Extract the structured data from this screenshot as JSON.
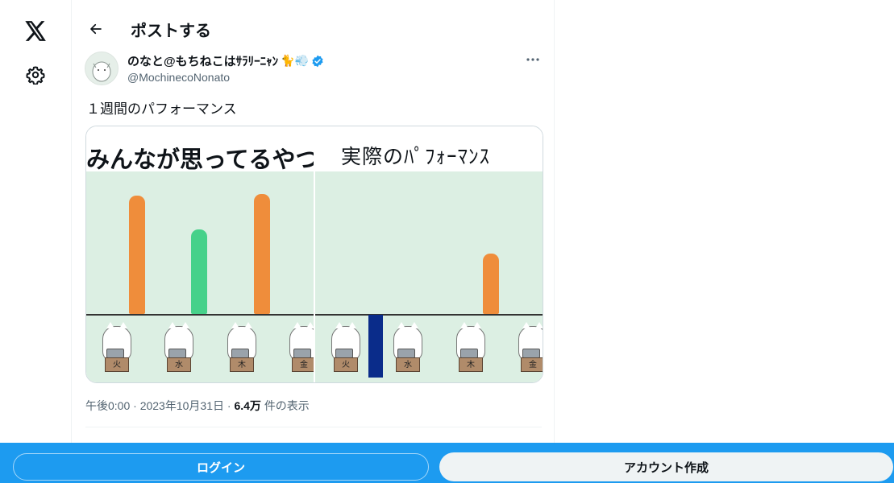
{
  "nav": {
    "logo_icon": "x-logo-icon",
    "settings_icon": "gear-icon"
  },
  "header": {
    "title": "ポストする",
    "back_icon": "arrow-left-icon"
  },
  "post": {
    "display_name": "のなと@もちねこはｻﾗﾘｰﾆｬﾝ",
    "name_emojis": "🐈💨",
    "handle": "@MochinecoNonato",
    "text": "１週間のパフォーマンス",
    "more_icon": "more-horizontal-icon"
  },
  "media": {
    "left_title": "みんなが思ってるやつ",
    "right_title": "実際のﾊﾟﾌｫｰﾏﾝｽ",
    "left_days": [
      "火",
      "水",
      "木",
      "金"
    ],
    "right_days": [
      "火",
      "水",
      "木",
      "金"
    ],
    "left_bars": [
      {
        "day": "火",
        "level": 0.78,
        "color": "#ef8d3b"
      },
      {
        "day": "水",
        "level": 0.5,
        "color": "#46d18a"
      },
      {
        "day": "木",
        "level": 0.79,
        "color": "#ef8d3b"
      }
    ],
    "right_bars": [
      {
        "day": "木",
        "level": 0.3,
        "color": "#ef8d3b"
      }
    ]
  },
  "meta": {
    "time": "午後0:00",
    "sep1": "·",
    "date": "2023年10月31日",
    "sep2": "·",
    "views_count": "6.4万",
    "views_label": "件の表示"
  },
  "bottom": {
    "login": "ログイン",
    "signup": "アカウント作成"
  },
  "colors": {
    "accent": "#1d9bf0",
    "verified": "#1d9bf0"
  }
}
